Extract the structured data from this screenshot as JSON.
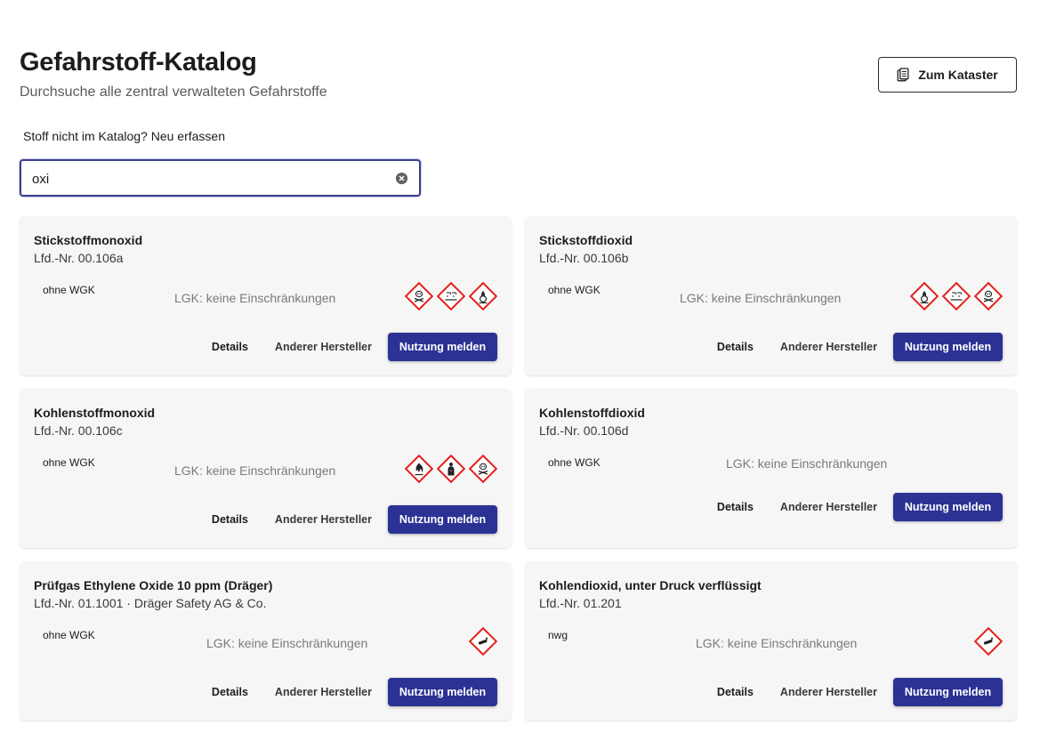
{
  "header": {
    "title": "Gefahrstoff-Katalog",
    "subtitle": "Durchsuche alle zentral verwalteten Gefahrstoffe",
    "kataster_button": "Zum Kataster"
  },
  "new_entry_link": "Stoff nicht im Katalog? Neu erfassen",
  "search": {
    "value": "oxi",
    "placeholder": ""
  },
  "card_actions": {
    "details": "Details",
    "other_manufacturer": "Anderer Hersteller",
    "report_usage": "Nutzung melden"
  },
  "colors": {
    "primary": "#2b3294",
    "ghs_red": "#e2231a"
  },
  "cards": [
    {
      "name": "Stickstoffmonoxid",
      "nr": "Lfd.-Nr. 00.106a",
      "wgk": "ohne WGK",
      "lgk": "LGK: keine Einschränkungen",
      "icons": [
        "skull-icon",
        "corrosion-icon",
        "oxidizer-icon"
      ]
    },
    {
      "name": "Stickstoffdioxid",
      "nr": "Lfd.-Nr. 00.106b",
      "wgk": "ohne WGK",
      "lgk": "LGK: keine Einschränkungen",
      "icons": [
        "oxidizer-icon",
        "corrosion-icon",
        "skull-icon"
      ]
    },
    {
      "name": "Kohlenstoffmonoxid",
      "nr": "Lfd.-Nr. 00.106c",
      "wgk": "ohne WGK",
      "lgk": "LGK: keine Einschränkungen",
      "icons": [
        "flame-icon",
        "health-hazard-icon",
        "skull-icon"
      ]
    },
    {
      "name": "Kohlenstoffdioxid",
      "nr": "Lfd.-Nr. 00.106d",
      "wgk": "ohne WGK",
      "lgk": "LGK: keine Einschränkungen",
      "icons": []
    },
    {
      "name": "Prüfgas Ethylene Oxide 10 ppm (Dräger)",
      "nr": "Lfd.-Nr. 01.1001 · Dräger Safety AG & Co.",
      "wgk": "ohne WGK",
      "lgk": "LGK: keine Einschränkungen",
      "icons": [
        "gas-cylinder-icon"
      ]
    },
    {
      "name": "Kohlendioxid, unter Druck verflüssigt",
      "nr": "Lfd.-Nr. 01.201",
      "wgk": "nwg",
      "lgk": "LGK: keine Einschränkungen",
      "icons": [
        "gas-cylinder-icon"
      ]
    }
  ]
}
